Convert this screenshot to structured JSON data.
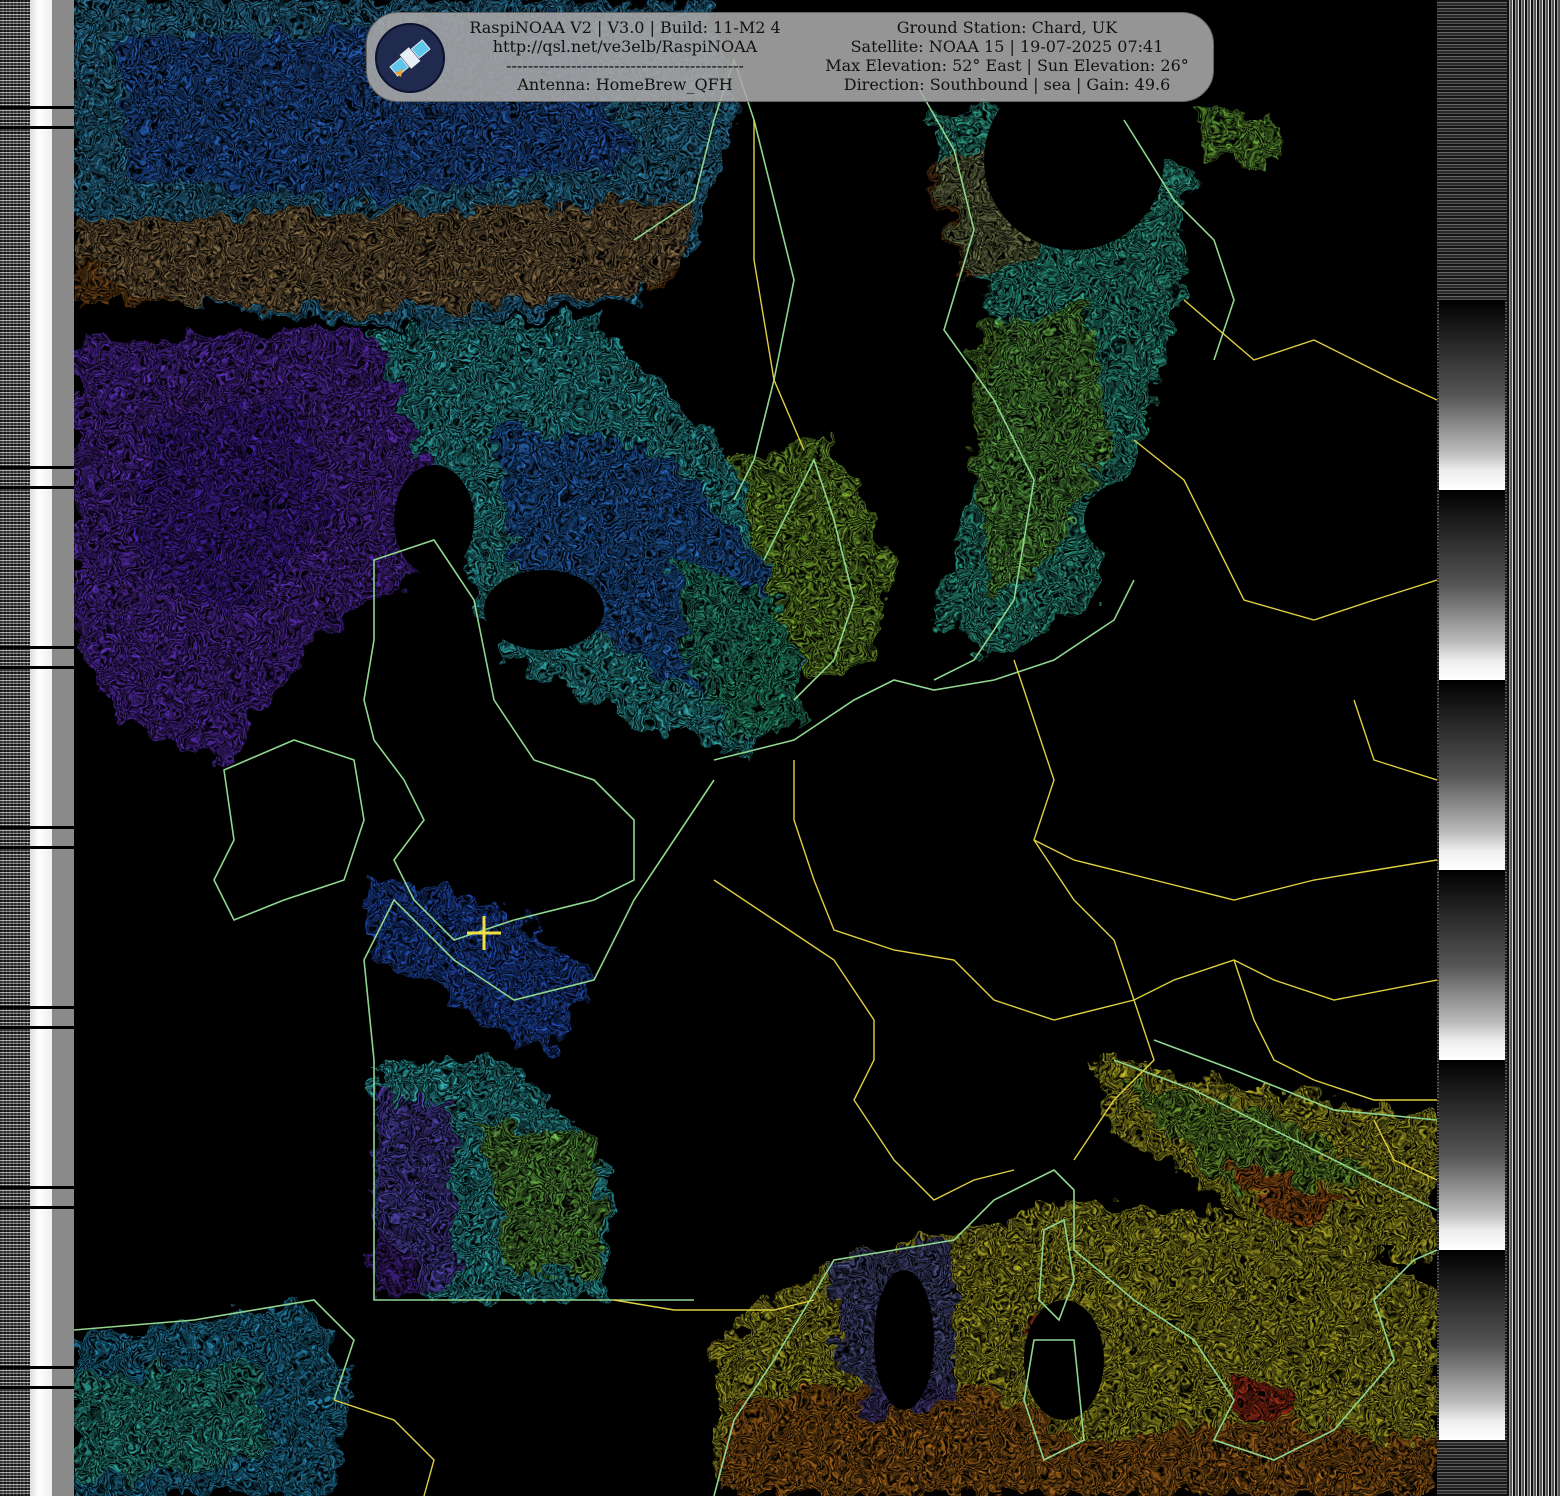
{
  "banner": {
    "left_lines": [
      "RaspiNOAA V2 | V3.0 | Build: 11-M2 4",
      "http://qsl.net/ve3elb/RaspiNOAA",
      "--------------------------------------------",
      "Antenna: HomeBrew_QFH"
    ],
    "right_lines": [
      "Ground Station: Chard, UK",
      "Satellite: NOAA 15 | 19-07-2025 07:41",
      "Max Elevation: 52° East | Sun Elevation: 26°",
      "Direction: Southbound | sea | Gain: 49.6"
    ],
    "logo_icon": "satellite-icon"
  },
  "map": {
    "ground_station_marker_icon": "crosshair-icon",
    "colors": {
      "coastline": "#8fd68f",
      "border": "#e0d040",
      "cloud_purple": "#7a3cf0",
      "cloud_blue": "#2f6cff",
      "cloud_cyan": "#3fe0e6",
      "cloud_green": "#8be04a",
      "warm_yellow": "#e8e030",
      "warm_orange": "#e07a20",
      "hot_red": "#e04020"
    }
  }
}
